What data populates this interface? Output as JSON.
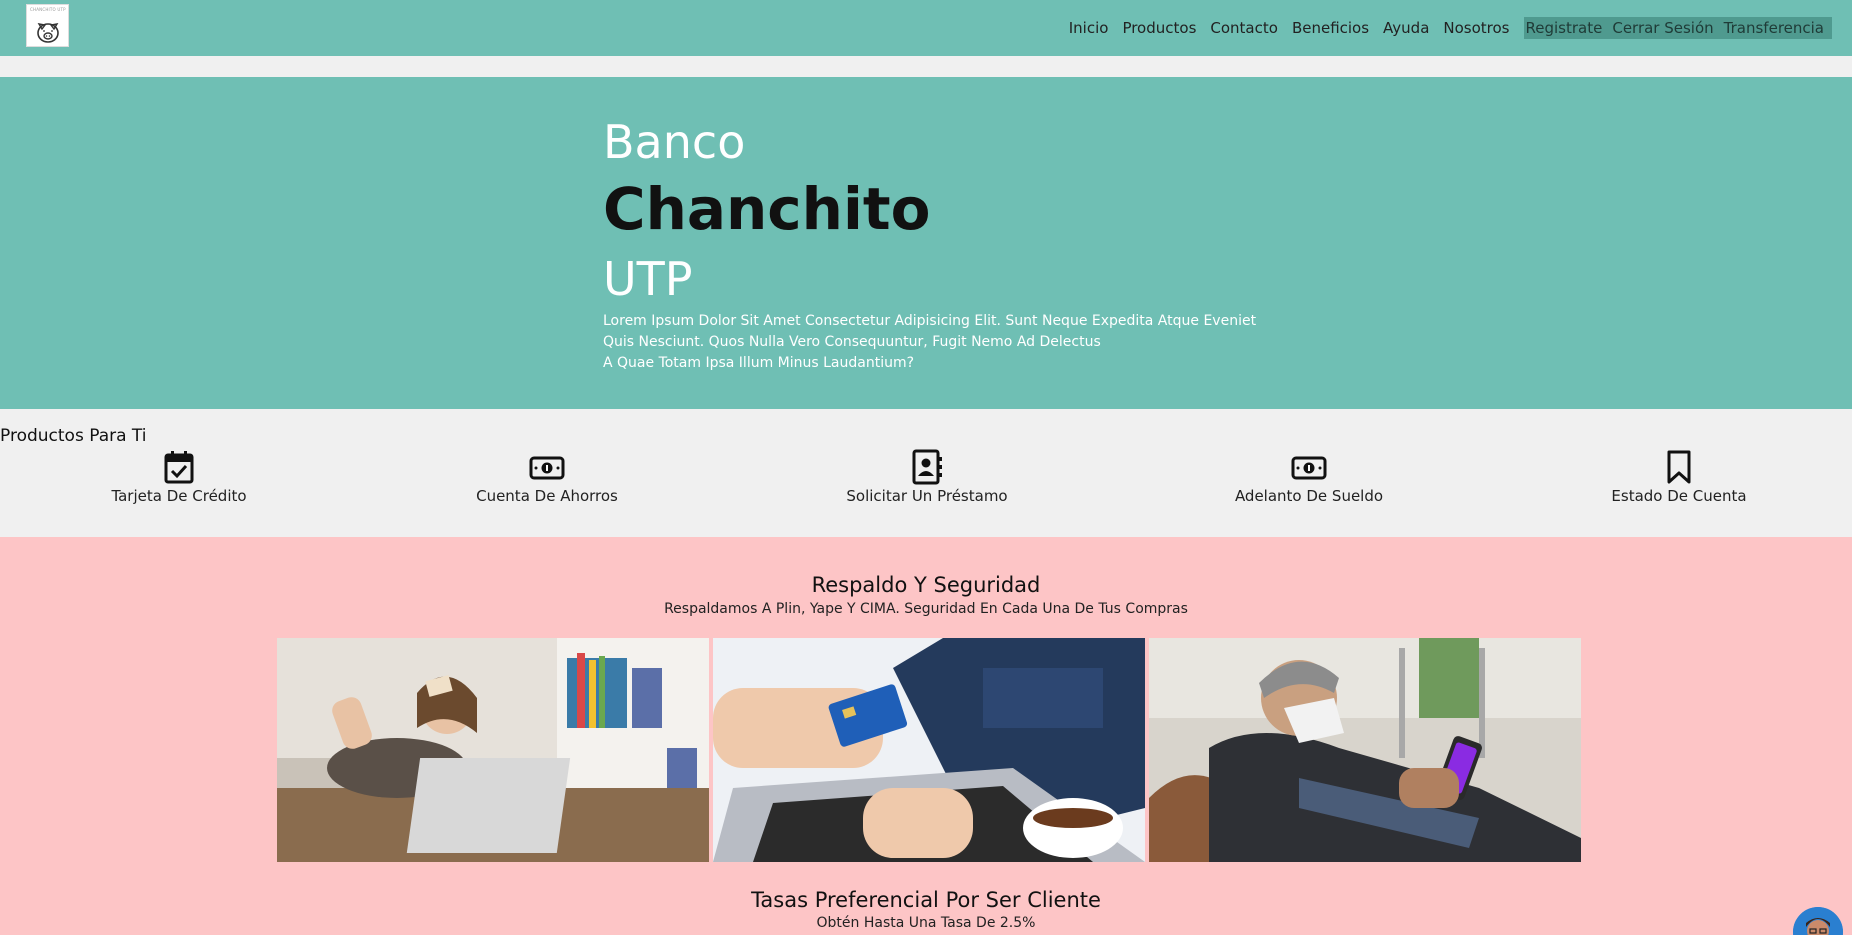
{
  "header": {
    "logo_text": "CHANCHITO UTP",
    "nav": [
      "Inicio",
      "Productos",
      "Contacto",
      "Beneficios",
      "Ayuda",
      "Nosotros"
    ],
    "nav_highlight": [
      "Registrate",
      "Cerrar Sesión",
      "Transferencia"
    ]
  },
  "hero": {
    "line1": "Banco",
    "line2": "Chanchito",
    "line3": "UTP",
    "text": [
      "Lorem Ipsum Dolor Sit Amet Consectetur Adipisicing Elit. Sunt Neque Expedita Atque Eveniet",
      "Quis Nesciunt. Quos Nulla Vero Consequuntur, Fugit Nemo Ad Delectus",
      "A Quae Totam Ipsa Illum Minus Laudantium?"
    ]
  },
  "products": {
    "title": "Productos Para Ti",
    "items": [
      {
        "label": "Tarjeta De Crédito",
        "icon": "calendar-check-icon"
      },
      {
        "label": "Cuenta De Ahorros",
        "icon": "money-bill-icon"
      },
      {
        "label": "Solicitar Un Préstamo",
        "icon": "address-book-icon"
      },
      {
        "label": "Adelanto De Sueldo",
        "icon": "money-bill-icon"
      },
      {
        "label": "Estado De Cuenta",
        "icon": "bookmark-icon"
      }
    ]
  },
  "seguridad": {
    "title": "Respaldo Y Seguridad",
    "subtitle": "Respaldamos A Plin, Yape Y CIMA. Seguridad En Cada Una De Tus Compras",
    "photos": [
      "woman-laptop-card-photo",
      "hands-laptop-card-photo",
      "man-mask-phone-photo"
    ]
  },
  "tasa": {
    "title": "Tasas Preferencial Por Ser Cliente",
    "subtitle": "Obtén Hasta Una Tasa De 2.5%"
  },
  "colors": {
    "teal": "#6fbfb4",
    "pink": "#fdc5c6",
    "gray": "#f0f0f0"
  }
}
